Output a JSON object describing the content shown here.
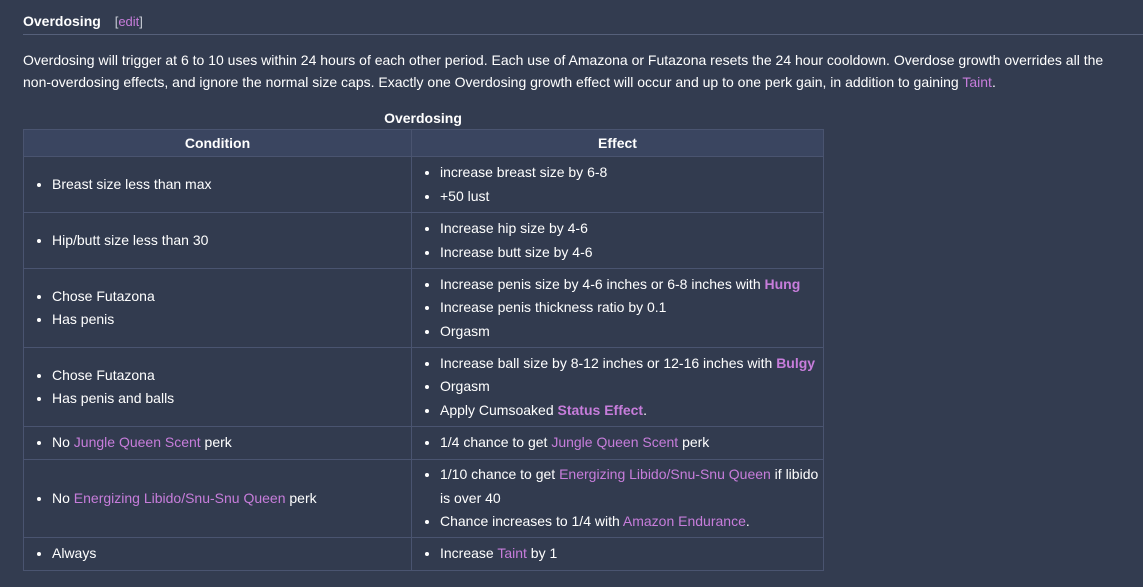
{
  "section": {
    "title": "Overdosing",
    "edit_open": "[",
    "edit_label": "edit",
    "edit_close": "]"
  },
  "intro": {
    "text_before_link": "Overdosing will trigger at 6 to 10 uses within 24 hours of each other period. Each use of Amazona or Futazona resets the 24 hour cooldown. Overdose growth overrides all the non-overdosing effects, and ignore the normal size caps. Exactly one Overdosing growth effect will occur and up to one perk gain, in addition to gaining ",
    "link": "Taint",
    "text_after_link": "."
  },
  "table": {
    "caption": "Overdosing",
    "headers": [
      "Condition",
      "Effect"
    ],
    "rows": [
      {
        "conditions": [
          {
            "parts": [
              {
                "t": "Breast size less than max"
              }
            ]
          }
        ],
        "effects": [
          {
            "parts": [
              {
                "t": "increase breast size by 6-8"
              }
            ]
          },
          {
            "parts": [
              {
                "t": "+50 lust"
              }
            ]
          }
        ]
      },
      {
        "conditions": [
          {
            "parts": [
              {
                "t": "Hip/butt size less than 30"
              }
            ]
          }
        ],
        "effects": [
          {
            "parts": [
              {
                "t": "Increase hip size by 4-6"
              }
            ]
          },
          {
            "parts": [
              {
                "t": "Increase butt size by 4-6"
              }
            ]
          }
        ]
      },
      {
        "conditions": [
          {
            "parts": [
              {
                "t": "Chose Futazona"
              }
            ]
          },
          {
            "parts": [
              {
                "t": "Has penis"
              }
            ]
          }
        ],
        "effects": [
          {
            "parts": [
              {
                "t": "Increase penis size by 4-6 inches or 6-8 inches with "
              },
              {
                "t": "Hung",
                "style": "link-bold"
              }
            ]
          },
          {
            "parts": [
              {
                "t": "Increase penis thickness ratio by 0.1"
              }
            ]
          },
          {
            "parts": [
              {
                "t": "Orgasm"
              }
            ]
          }
        ]
      },
      {
        "conditions": [
          {
            "parts": [
              {
                "t": "Chose Futazona"
              }
            ]
          },
          {
            "parts": [
              {
                "t": "Has penis and balls"
              }
            ]
          }
        ],
        "effects": [
          {
            "parts": [
              {
                "t": "Increase ball size by 8-12 inches or 12-16 inches with "
              },
              {
                "t": "Bulgy",
                "style": "link-bold"
              }
            ]
          },
          {
            "parts": [
              {
                "t": "Orgasm"
              }
            ]
          },
          {
            "parts": [
              {
                "t": "Apply Cumsoaked "
              },
              {
                "t": "Status Effect",
                "style": "link-bold"
              },
              {
                "t": "."
              }
            ]
          }
        ]
      },
      {
        "conditions": [
          {
            "parts": [
              {
                "t": "No "
              },
              {
                "t": "Jungle Queen Scent",
                "style": "link"
              },
              {
                "t": " perk"
              }
            ]
          }
        ],
        "effects": [
          {
            "parts": [
              {
                "t": "1/4 chance to get "
              },
              {
                "t": "Jungle Queen Scent",
                "style": "link"
              },
              {
                "t": " perk"
              }
            ]
          }
        ]
      },
      {
        "conditions": [
          {
            "parts": [
              {
                "t": "No "
              },
              {
                "t": "Energizing Libido/Snu-Snu Queen",
                "style": "link"
              },
              {
                "t": " perk"
              }
            ]
          }
        ],
        "effects": [
          {
            "parts": [
              {
                "t": "1/10 chance to get "
              },
              {
                "t": "Energizing Libido/Snu-Snu Queen",
                "style": "link"
              },
              {
                "t": " if libido is over 40"
              }
            ]
          },
          {
            "parts": [
              {
                "t": "Chance increases to 1/4 with "
              },
              {
                "t": "Amazon Endurance",
                "style": "link"
              },
              {
                "t": "."
              }
            ]
          }
        ]
      },
      {
        "conditions": [
          {
            "parts": [
              {
                "t": "Always"
              }
            ]
          }
        ],
        "effects": [
          {
            "parts": [
              {
                "t": "Increase "
              },
              {
                "t": "Taint",
                "style": "link"
              },
              {
                "t": " by 1"
              }
            ]
          }
        ]
      }
    ]
  },
  "colors": {
    "background": "#333c50",
    "link": "#c77ddb",
    "header_bg": "#3a4560",
    "border": "#4a5470"
  }
}
